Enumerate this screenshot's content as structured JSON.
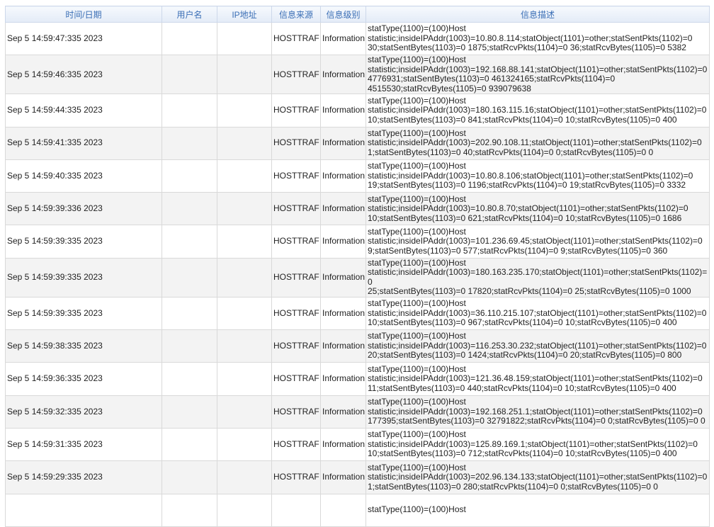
{
  "columns": [
    "时间/日期",
    "用户名",
    "IP地址",
    "信息来源",
    "信息级别",
    "信息描述"
  ],
  "rows": [
    {
      "time": "Sep  5 14:59:47:335 2023",
      "user": "",
      "ip": "",
      "source": "HOSTTRAF",
      "level": "Information",
      "desc": "statType(1100)=(100)Host\nstatistic;insideIPAddr(1003)=10.80.8.114;statObject(1101)=other;statSentPkts(1102)=0\n30;statSentBytes(1103)=0 1875;statRcvPkts(1104)=0 36;statRcvBytes(1105)=0 5382"
    },
    {
      "time": "Sep  5 14:59:46:335 2023",
      "user": "",
      "ip": "",
      "source": "HOSTTRAF",
      "level": "Information",
      "desc": "statType(1100)=(100)Host\nstatistic;insideIPAddr(1003)=192.168.88.141;statObject(1101)=other;statSentPkts(1102)=0\n4776931;statSentBytes(1103)=0 461324165;statRcvPkts(1104)=0\n4515530;statRcvBytes(1105)=0 939079638"
    },
    {
      "time": "Sep  5 14:59:44:335 2023",
      "user": "",
      "ip": "",
      "source": "HOSTTRAF",
      "level": "Information",
      "desc": "statType(1100)=(100)Host\nstatistic;insideIPAddr(1003)=180.163.115.16;statObject(1101)=other;statSentPkts(1102)=0\n10;statSentBytes(1103)=0 841;statRcvPkts(1104)=0 10;statRcvBytes(1105)=0 400"
    },
    {
      "time": "Sep  5 14:59:41:335 2023",
      "user": "",
      "ip": "",
      "source": "HOSTTRAF",
      "level": "Information",
      "desc": "statType(1100)=(100)Host\nstatistic;insideIPAddr(1003)=202.90.108.11;statObject(1101)=other;statSentPkts(1102)=0\n1;statSentBytes(1103)=0 40;statRcvPkts(1104)=0 0;statRcvBytes(1105)=0 0"
    },
    {
      "time": "Sep  5 14:59:40:335 2023",
      "user": "",
      "ip": "",
      "source": "HOSTTRAF",
      "level": "Information",
      "desc": "statType(1100)=(100)Host\nstatistic;insideIPAddr(1003)=10.80.8.106;statObject(1101)=other;statSentPkts(1102)=0\n19;statSentBytes(1103)=0 1196;statRcvPkts(1104)=0 19;statRcvBytes(1105)=0 3332"
    },
    {
      "time": "Sep  5 14:59:39:336 2023",
      "user": "",
      "ip": "",
      "source": "HOSTTRAF",
      "level": "Information",
      "desc": "statType(1100)=(100)Host\nstatistic;insideIPAddr(1003)=10.80.8.70;statObject(1101)=other;statSentPkts(1102)=0\n10;statSentBytes(1103)=0 621;statRcvPkts(1104)=0 10;statRcvBytes(1105)=0 1686"
    },
    {
      "time": "Sep  5 14:59:39:335 2023",
      "user": "",
      "ip": "",
      "source": "HOSTTRAF",
      "level": "Information",
      "desc": "statType(1100)=(100)Host\nstatistic;insideIPAddr(1003)=101.236.69.45;statObject(1101)=other;statSentPkts(1102)=0\n9;statSentBytes(1103)=0 577;statRcvPkts(1104)=0 9;statRcvBytes(1105)=0 360"
    },
    {
      "time": "Sep  5 14:59:39:335 2023",
      "user": "",
      "ip": "",
      "source": "HOSTTRAF",
      "level": "Information",
      "desc": "statType(1100)=(100)Host\nstatistic;insideIPAddr(1003)=180.163.235.170;statObject(1101)=other;statSentPkts(1102)=0\n25;statSentBytes(1103)=0 17820;statRcvPkts(1104)=0 25;statRcvBytes(1105)=0 1000"
    },
    {
      "time": "Sep  5 14:59:39:335 2023",
      "user": "",
      "ip": "",
      "source": "HOSTTRAF",
      "level": "Information",
      "desc": "statType(1100)=(100)Host\nstatistic;insideIPAddr(1003)=36.110.215.107;statObject(1101)=other;statSentPkts(1102)=0\n10;statSentBytes(1103)=0 967;statRcvPkts(1104)=0 10;statRcvBytes(1105)=0 400"
    },
    {
      "time": "Sep  5 14:59:38:335 2023",
      "user": "",
      "ip": "",
      "source": "HOSTTRAF",
      "level": "Information",
      "desc": "statType(1100)=(100)Host\nstatistic;insideIPAddr(1003)=116.253.30.232;statObject(1101)=other;statSentPkts(1102)=0\n20;statSentBytes(1103)=0 1424;statRcvPkts(1104)=0 20;statRcvBytes(1105)=0 800"
    },
    {
      "time": "Sep  5 14:59:36:335 2023",
      "user": "",
      "ip": "",
      "source": "HOSTTRAF",
      "level": "Information",
      "desc": "statType(1100)=(100)Host\nstatistic;insideIPAddr(1003)=121.36.48.159;statObject(1101)=other;statSentPkts(1102)=0\n11;statSentBytes(1103)=0 440;statRcvPkts(1104)=0 10;statRcvBytes(1105)=0 400"
    },
    {
      "time": "Sep  5 14:59:32:335 2023",
      "user": "",
      "ip": "",
      "source": "HOSTTRAF",
      "level": "Information",
      "desc": "statType(1100)=(100)Host\nstatistic;insideIPAddr(1003)=192.168.251.1;statObject(1101)=other;statSentPkts(1102)=0\n177395;statSentBytes(1103)=0 32791822;statRcvPkts(1104)=0 0;statRcvBytes(1105)=0 0"
    },
    {
      "time": "Sep  5 14:59:31:335 2023",
      "user": "",
      "ip": "",
      "source": "HOSTTRAF",
      "level": "Information",
      "desc": "statType(1100)=(100)Host\nstatistic;insideIPAddr(1003)=125.89.169.1;statObject(1101)=other;statSentPkts(1102)=0\n10;statSentBytes(1103)=0 712;statRcvPkts(1104)=0 10;statRcvBytes(1105)=0 400"
    },
    {
      "time": "Sep  5 14:59:29:335 2023",
      "user": "",
      "ip": "",
      "source": "HOSTTRAF",
      "level": "Information",
      "desc": "statType(1100)=(100)Host\nstatistic;insideIPAddr(1003)=202.96.134.133;statObject(1101)=other;statSentPkts(1102)=0\n1;statSentBytes(1103)=0 280;statRcvPkts(1104)=0 0;statRcvBytes(1105)=0 0"
    },
    {
      "time": "",
      "user": "",
      "ip": "",
      "source": "",
      "level": "",
      "desc": "statType(1100)=(100)Host"
    }
  ]
}
